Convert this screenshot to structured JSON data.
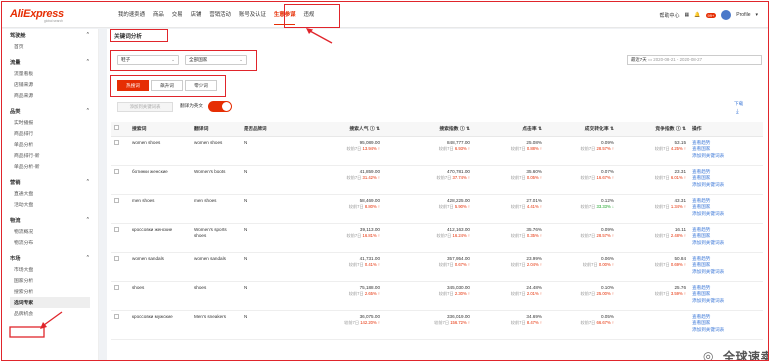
{
  "logo": {
    "brand": "AliExpress",
    "sub": "global search"
  },
  "nav": {
    "items": [
      "我的速卖通",
      "商品",
      "交易",
      "店铺",
      "营销活动",
      "账号及认证",
      "生意参谋",
      "违规"
    ],
    "active_index": 6
  },
  "top_right": {
    "help": "帮助中心",
    "badge": "99+",
    "profile": "Profile"
  },
  "sidebar": {
    "groups": [
      {
        "title": "驾驶舱",
        "items": [
          "首页"
        ]
      },
      {
        "title": "流量",
        "items": [
          "流量看板",
          "店铺来源",
          "商品来源"
        ]
      },
      {
        "title": "品类",
        "items": [
          "实时播报",
          "商品排行",
          "单品分析",
          "商品排行-新",
          "单品分析-新"
        ]
      },
      {
        "title": "营销",
        "items": [
          "直通大盘",
          "活动大盘"
        ]
      },
      {
        "title": "物流",
        "items": [
          "物流概况",
          "物流分布"
        ]
      },
      {
        "title": "市场",
        "items": [
          "市场大盘",
          "国家分析",
          "搜索分析",
          "选词专家",
          "品牌机会"
        ]
      }
    ],
    "active_item": "选词专家"
  },
  "main": {
    "title": "关键词分析",
    "filters": {
      "category": "鞋子",
      "country": "全部国家"
    },
    "date": {
      "range": "最近7天",
      "value": "2020-08-21 - 2020-08-27"
    },
    "tabs": [
      "热搜词",
      "飙升词",
      "零少词"
    ],
    "active_tab": 0,
    "add_button": "添加到关键词表",
    "translate_label": "翻译为英文",
    "translate_on": true,
    "download": "下载"
  },
  "table": {
    "headers": [
      "搜索词",
      "翻译词",
      "是否品牌词",
      "搜索人气 ⓘ ⇅",
      "搜索指数 ⓘ ⇅",
      "点击率 ⇅",
      "成交转化率 ⇅",
      "竞争指数 ⓘ ⇅",
      "操作"
    ],
    "rows": [
      {
        "term": "women shoes",
        "translation": "women shoes",
        "brand": "N",
        "pop": "95,089.00",
        "pop_sub": "较前7日",
        "pop_chg": "13.94%",
        "pop_dir": "up",
        "idx": "848,777.00",
        "idx_chg": "6.93%",
        "idx_dir": "up",
        "ctr": "25.08%",
        "ctr_chg": "0.88%",
        "ctr_dir": "up",
        "cvr": "0.09%",
        "cvr_chg": "28.57%",
        "cvr_dir": "up",
        "comp": "53.15",
        "comp_chg": "4.25%",
        "comp_dir": "up"
      },
      {
        "term": "ботинки женские",
        "translation": "Women's boots",
        "brand": "N",
        "pop": "41,859.00",
        "pop_sub": "较前7日",
        "pop_chg": "31.42%",
        "pop_dir": "up",
        "idx": "470,781.00",
        "idx_chg": "37.74%",
        "idx_dir": "up",
        "ctr": "35.60%",
        "ctr_chg": "0.05%",
        "ctr_dir": "up",
        "cvr": "0.07%",
        "cvr_chg": "16.67%",
        "cvr_dir": "up",
        "comp": "23.31",
        "comp_chg": "6.01%",
        "comp_dir": "up"
      },
      {
        "term": "men shoes",
        "translation": "men shoes",
        "brand": "N",
        "pop": "58,469.00",
        "pop_sub": "较前7日",
        "pop_chg": "8.80%",
        "pop_dir": "up",
        "idx": "428,225.00",
        "idx_chg": "5.90%",
        "idx_dir": "up",
        "ctr": "27.01%",
        "ctr_chg": "4.41%",
        "ctr_dir": "up",
        "cvr": "0.12%",
        "cvr_chg": "33.33%",
        "cvr_dir": "down",
        "comp": "43.31",
        "comp_chg": "1.34%",
        "comp_dir": "up"
      },
      {
        "term": "кроссовки женские",
        "translation": "Women's sports shoes",
        "brand": "N",
        "pop": "39,113.00",
        "pop_sub": "较前7日",
        "pop_chg": "16.81%",
        "pop_dir": "up",
        "idx": "412,163.00",
        "idx_chg": "16.24%",
        "idx_dir": "up",
        "ctr": "35.76%",
        "ctr_chg": "0.35%",
        "ctr_dir": "up",
        "cvr": "0.09%",
        "cvr_chg": "28.57%",
        "cvr_dir": "up",
        "comp": "16.11",
        "comp_chg": "2.48%",
        "comp_dir": "up"
      },
      {
        "term": "women sandals",
        "translation": "women sandals",
        "brand": "N",
        "pop": "41,731.00",
        "pop_sub": "较前7日",
        "pop_chg": "0.41%",
        "pop_dir": "up",
        "idx": "357,954.00",
        "idx_chg": "0.67%",
        "idx_dir": "up",
        "ctr": "23.99%",
        "ctr_chg": "2.04%",
        "ctr_dir": "up",
        "cvr": "0.06%",
        "cvr_chg": "0.00%",
        "cvr_dir": "up",
        "comp": "50.84",
        "comp_chg": "0.69%",
        "comp_dir": "up"
      },
      {
        "term": "shoes",
        "translation": "shoes",
        "brand": "N",
        "pop": "75,188.00",
        "pop_sub": "较前7日",
        "pop_chg": "2.65%",
        "pop_dir": "up",
        "idx": "345,030.00",
        "idx_chg": "2.30%",
        "idx_dir": "up",
        "ctr": "24.48%",
        "ctr_chg": "2.01%",
        "ctr_dir": "up",
        "cvr": "0.10%",
        "cvr_chg": "25.00%",
        "cvr_dir": "up",
        "comp": "25.76",
        "comp_chg": "3.59%",
        "comp_dir": "up"
      },
      {
        "term": "кроссовки мужские",
        "translation": "Men's sneakers",
        "brand": "N",
        "pop": "36,075.00",
        "pop_sub": "较前7日",
        "pop_chg": "142.20%",
        "pop_dir": "up",
        "idx": "336,019.00",
        "idx_chg": "156.72%",
        "idx_dir": "up",
        "ctr": "34.69%",
        "ctr_chg": "8.47%",
        "ctr_dir": "up",
        "cvr": "0.05%",
        "cvr_chg": "66.67%",
        "cvr_dir": "up",
        "comp": "",
        "comp_chg": "",
        "comp_dir": "up"
      }
    ],
    "ops": [
      "查看趋势",
      "查看国家",
      "添加到关键词表"
    ]
  },
  "watermark": "全球速卖通资讯",
  "colors": {
    "accent": "#e62e04",
    "link": "#3f7ad8",
    "annotation": "#e0252b",
    "up": "#e62e04",
    "down": "#1aa326"
  }
}
